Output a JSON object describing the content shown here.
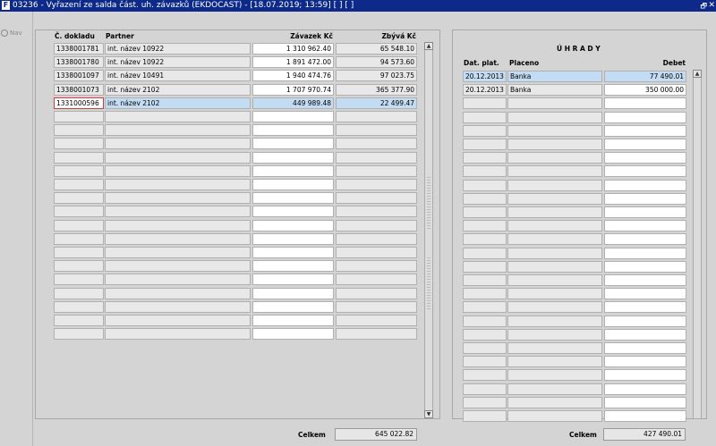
{
  "window": {
    "title": "03236 - Vyřazení ze salda část. uh. závazků (EKDOCAST) - [18.07.2019; 13:59]  [ ]  [ ]",
    "logo": "F",
    "restore_glyph": "🗗",
    "close_glyph": "✕"
  },
  "nav": {
    "label": "Nav"
  },
  "left_table": {
    "headers": {
      "doc": "Č. dokladu",
      "partner": "Partner",
      "amount": "Závazek Kč",
      "remaining": "Zbývá Kč"
    },
    "rows": [
      {
        "doc": "1338001781",
        "partner": "int. název 10922",
        "amount": "1 310 962.40",
        "remaining": "65 548.10"
      },
      {
        "doc": "1338001780",
        "partner": "int. název 10922",
        "amount": "1 891 472.00",
        "remaining": "94 573.60"
      },
      {
        "doc": "1338001097",
        "partner": "int. název 10491",
        "amount": "1 940 474.76",
        "remaining": "97 023.75"
      },
      {
        "doc": "1338001073",
        "partner": "int. název 2102",
        "amount": "1 707 970.74",
        "remaining": "365 377.90"
      },
      {
        "doc": "1331000596",
        "partner": "int. název 2102",
        "amount": "449 989.48",
        "remaining": "22 499.47"
      }
    ],
    "selected_index": 4,
    "total_label": "Celkem",
    "total_value": "645 022.82"
  },
  "right_table": {
    "title": "Ú H R A D Y",
    "headers": {
      "date": "Dat. plat.",
      "paid": "Placeno",
      "debit": "Debet"
    },
    "rows": [
      {
        "date": "20.12.2013",
        "paid": "Banka",
        "debit": "77 490.01"
      },
      {
        "date": "20.12.2013",
        "paid": "Banka",
        "debit": "350 000.00"
      }
    ],
    "selected_index": 0,
    "total_label": "Celkem",
    "total_value": "427 490.01"
  }
}
